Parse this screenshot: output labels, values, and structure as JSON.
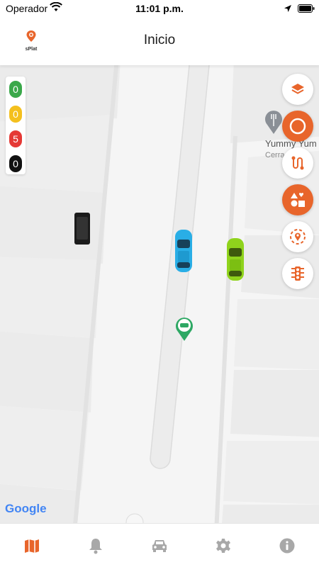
{
  "status_bar": {
    "carrier": "Operador",
    "time": "11:01 p.m."
  },
  "header": {
    "logo_text": "sPlat",
    "title": "Inicio"
  },
  "counters": [
    {
      "value": "0",
      "color": "#3aa84a"
    },
    {
      "value": "0",
      "color": "#f4c01e"
    },
    {
      "value": "5",
      "color": "#e53935"
    },
    {
      "value": "0",
      "color": "#111111"
    }
  ],
  "map": {
    "poi_name": "Yummy Yum",
    "poi_sub": "Cerra",
    "attribution": "Google"
  },
  "fabs": [
    {
      "name": "layers-icon",
      "style": "white"
    },
    {
      "name": "circle-draw-icon",
      "style": "orange"
    },
    {
      "name": "route-icon",
      "style": "white"
    },
    {
      "name": "shapes-icon",
      "style": "orange"
    },
    {
      "name": "location-target-icon",
      "style": "white"
    },
    {
      "name": "traffic-light-icon",
      "style": "white"
    }
  ],
  "bottom_nav": [
    {
      "name": "map-icon",
      "active": true
    },
    {
      "name": "bell-icon",
      "active": false
    },
    {
      "name": "car-icon",
      "active": false
    },
    {
      "name": "gear-icon",
      "active": false
    },
    {
      "name": "info-icon",
      "active": false
    }
  ],
  "colors": {
    "accent": "#e8652b",
    "nav_inactive": "#a8a8a8"
  }
}
